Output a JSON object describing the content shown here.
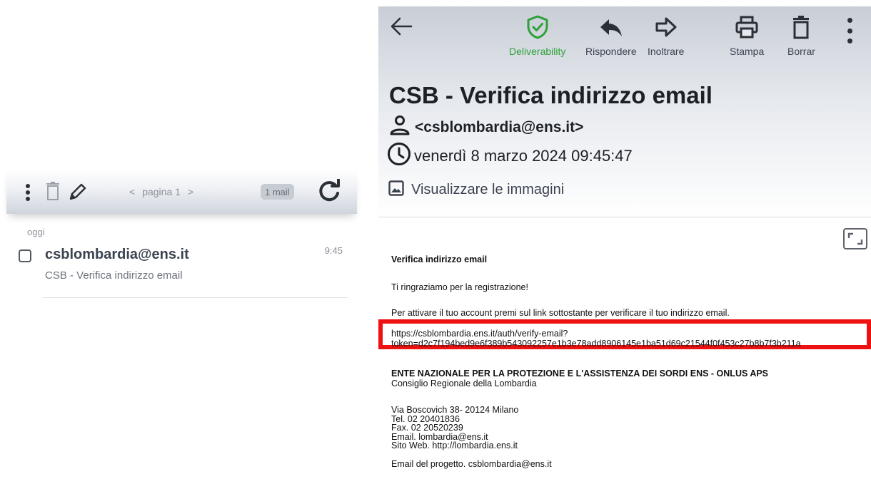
{
  "list": {
    "toolbar": {
      "pager_prev": "<",
      "pager_label": "pagina 1",
      "pager_next": ">",
      "mail_count": "1 mail"
    },
    "day_label": "oggi",
    "items": [
      {
        "sender": "csblombardia@ens.it",
        "subject": "CSB - Verifica indirizzo email",
        "time": "9:45"
      }
    ]
  },
  "reader": {
    "actions": {
      "deliverability": "Deliverability",
      "reply": "Rispondere",
      "forward": "Inoltrare",
      "print": "Stampa",
      "delete": "Borrar"
    },
    "subject": "CSB - Verifica indirizzo email",
    "from": "<csblombardia@ens.it>",
    "date": "venerdì 8 marzo 2024 09:45:47",
    "show_images": "Visualizzare le immagini",
    "body": {
      "title": "Verifica indirizzo email",
      "thanks": "Ti ringraziamo per la registrazione!",
      "instructions": "Per attivare il tuo account premi sul link sottostante per verificare il tuo indirizzo email.",
      "link_line1": "https://csblombardia.ens.it/auth/verify-email?",
      "link_line2": "token=d2c7f194bed9e6f389b543092257e1b3e78add8906145e1ba51d69c21544f0f453c27b8b7f3b211a",
      "org": "ENTE NAZIONALE PER LA PROTEZIONE E L'ASSISTENZA DEI SORDI ENS - ONLUS APS",
      "council": "Consiglio Regionale della Lombardia",
      "address": "Via Boscovich 38- 20124 Milano",
      "tel": "Tel. 02 20401836",
      "fax": "Fax. 02 20520239",
      "email": "Email. lombardia@ens.it",
      "web": "Sito Web. http://lombardia.ens.it",
      "project_email": "Email del progetto. csblombardia@ens.it"
    }
  },
  "colors": {
    "accent_green": "#2ea13a",
    "highlight_red": "#ee1111",
    "icon_dark": "#2b2f36"
  }
}
